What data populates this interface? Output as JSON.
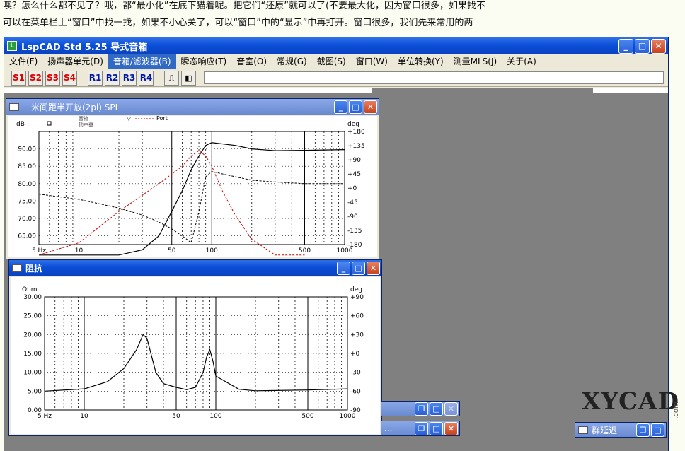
{
  "caption": {
    "line1": "噢？怎么什么都不见了？哦，都“最小化”在底下猫着呢。把它们“还原”就可以了(不要最大化，因为窗口很多，如果找不",
    "line2": "可以在菜单栏上“窗口”中找一找，如果不小心关了，可以“窗口”中的“显示”中再打开。窗口很多，我们先来常用的两"
  },
  "app": {
    "title": "LspCAD Std 5.25 导式音箱",
    "menu": [
      "文件(F)",
      "扬声器单元(D)",
      "音箱/滤波器(B)",
      "瞬态响应(T)",
      "音室(O)",
      "常规(G)",
      "截图(S)",
      "窗口(W)",
      "单位转换(Y)",
      "测量MLS(J)",
      "关于(A)"
    ],
    "active_menu_index": 2,
    "toolbar_s": [
      "S1",
      "S2",
      "S3",
      "S4"
    ],
    "toolbar_r": [
      "R1",
      "R2",
      "R3",
      "R4"
    ]
  },
  "spl_window": {
    "title": "一米间距半开放(2pi) SPL",
    "y_unit": "dB",
    "y2_unit": "deg",
    "legend": [
      "音箱",
      "扬声器",
      "Port"
    ],
    "y_ticks": [
      "90.00",
      "85.00",
      "80.00",
      "75.00",
      "70.00",
      "65.00"
    ],
    "y2_ticks": [
      "+180",
      "+135",
      "+90",
      "+45",
      "+0",
      "-45",
      "-90",
      "-135",
      "-180"
    ],
    "x_ticks": [
      "5 Hz",
      "10",
      "50",
      "100",
      "500",
      "1000"
    ]
  },
  "imp_window": {
    "title": "阻抗",
    "y_unit": "Ohm",
    "y2_unit": "deg",
    "y_ticks": [
      "30.00",
      "25.00",
      "20.00",
      "15.00",
      "10.00",
      "5.00",
      "0.00"
    ],
    "y2_ticks": [
      "+90",
      "+60",
      "+30",
      "+0",
      "-30",
      "-60",
      "-90"
    ],
    "x_ticks": [
      "5 Hz",
      "10",
      "50",
      "100",
      "500",
      "1000"
    ]
  },
  "minimized": {
    "bar1_label": "",
    "bar2_label": "...",
    "delay_label": "群延迟"
  },
  "watermark": {
    "text": "XYCAD",
    "suffix": ".com"
  },
  "chart_data": [
    {
      "type": "line",
      "title": "一米间距半开放(2pi) SPL",
      "x_scale": "log",
      "xlim": [
        5,
        1000
      ],
      "ylim": [
        62.5,
        95
      ],
      "y2lim": [
        -180,
        180
      ],
      "series": [
        {
          "name": "音箱",
          "x": [
            5,
            10,
            20,
            30,
            40,
            50,
            60,
            70,
            80,
            90,
            100,
            150,
            200,
            300,
            500,
            1000
          ],
          "y": [
            50,
            54,
            58,
            61,
            65,
            72,
            78,
            84,
            88,
            91,
            91.8,
            91,
            90,
            89.5,
            89.6,
            89.8
          ]
        },
        {
          "name": "扬声器",
          "x": [
            5,
            10,
            20,
            30,
            40,
            50,
            60,
            70,
            80,
            90,
            100,
            150,
            200,
            300,
            500,
            1000
          ],
          "y": [
            77,
            75.5,
            73,
            71,
            69,
            67,
            65,
            63,
            72,
            82,
            83.5,
            82,
            81,
            80.5,
            80,
            80
          ]
        },
        {
          "name": "Port",
          "x": [
            5,
            10,
            20,
            40,
            60,
            70,
            80,
            90,
            100,
            120,
            150,
            200,
            300,
            500
          ],
          "y": [
            55,
            63,
            72,
            80,
            85,
            88,
            89.5,
            88,
            85,
            78,
            71,
            64,
            55,
            45
          ]
        }
      ]
    },
    {
      "type": "line",
      "title": "阻抗",
      "x_scale": "log",
      "xlim": [
        5,
        1000
      ],
      "ylim": [
        0,
        30
      ],
      "y2lim": [
        -90,
        90
      ],
      "series": [
        {
          "name": "",
          "x": [
            5,
            10,
            15,
            20,
            25,
            28,
            30,
            35,
            40,
            50,
            60,
            70,
            80,
            85,
            90,
            95,
            100,
            150,
            200,
            500,
            1000
          ],
          "y": [
            5,
            5.6,
            7.5,
            11,
            16,
            20,
            19,
            10,
            7,
            6,
            5.4,
            6,
            10,
            14,
            16,
            13,
            9,
            5.5,
            5.1,
            5.3,
            5.6
          ]
        }
      ]
    }
  ]
}
